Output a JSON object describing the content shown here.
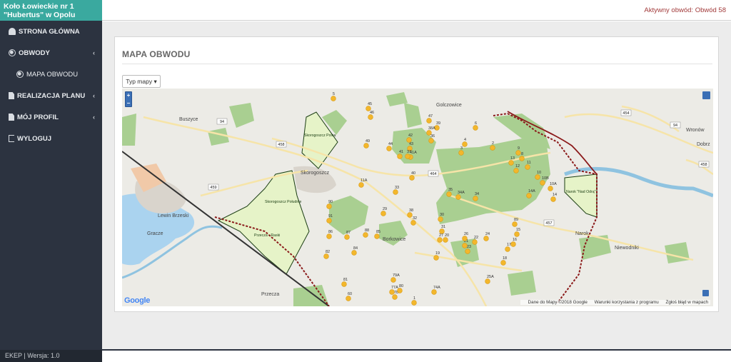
{
  "app": {
    "name_line1": "Koło Łowieckie nr 1",
    "name_line2": "\"Hubertus\" w Opolu",
    "version": "EKEP | Wersja: 1.0"
  },
  "topbar": {
    "active_circuit": "Aktywny obwód: Obwód 58"
  },
  "sidebar": {
    "items": [
      {
        "label": "STRONA GŁÓWNA",
        "icon": "dashboard-icon",
        "has_chevron": false
      },
      {
        "label": "OBWODY",
        "icon": "globe-icon",
        "has_chevron": true
      },
      {
        "label": "MAPA OBWODU",
        "icon": "globe-icon",
        "has_chevron": false
      },
      {
        "label": "REALIZACJA PLANU",
        "icon": "file-icon",
        "has_chevron": true
      },
      {
        "label": "MÓJ PROFIL",
        "icon": "file-icon",
        "has_chevron": true
      },
      {
        "label": "WYLOGUJ",
        "icon": "logout-icon",
        "has_chevron": false
      }
    ],
    "chevron": "‹"
  },
  "panel": {
    "title": "MAPA OBWODU",
    "map_type_button": "Typ mapy ▾"
  },
  "map": {
    "zoom_in": "+",
    "zoom_out": "−",
    "google_logo": "Google",
    "attribution": "Dane do Mapy ©2018 Google",
    "terms": "Warunki korzystania z programu",
    "report": "Zgłoś błąd w mapach",
    "places": [
      "Buszyce",
      "Golczowice",
      "Skorogoszcz",
      "Lewin Brzeski",
      "Borkowice",
      "Przecza",
      "Narok",
      "Niewodniki",
      "Dobrz",
      "Wronów",
      "Gracze"
    ],
    "areas": [
      "Skorogoszcz Polna",
      "Skorogoszcz Południe",
      "Przecza - Raski",
      "Narok \"Nad Odrą\""
    ],
    "roads": [
      "94",
      "458",
      "459",
      "464",
      "457",
      "454"
    ],
    "markers": [
      "5",
      "45",
      "46",
      "47",
      "39",
      "38A",
      "36",
      "6",
      "4",
      "3",
      "2",
      "49",
      "44",
      "42",
      "43",
      "41A",
      "41",
      "37",
      "9",
      "8",
      "13",
      "12",
      "11",
      "10",
      "10B",
      "10A",
      "14",
      "14A",
      "11A",
      "35",
      "34A",
      "34",
      "40",
      "33",
      "29",
      "38",
      "32",
      "30",
      "31",
      "27",
      "25A",
      "23",
      "21",
      "22",
      "24",
      "26",
      "20",
      "19",
      "18",
      "17",
      "16",
      "15",
      "89",
      "90",
      "91",
      "86",
      "87",
      "88",
      "85",
      "84",
      "82",
      "81",
      "79A",
      "77A",
      "78",
      "80",
      "60",
      "74A",
      "1"
    ],
    "colors": {
      "forest": "#a9cf91",
      "hunting_area": "#e6f3c8",
      "marker": "#f3b72c",
      "boundary": "#8b1a1a",
      "river": "#8fc3e0",
      "water": "#aad3ef"
    }
  }
}
